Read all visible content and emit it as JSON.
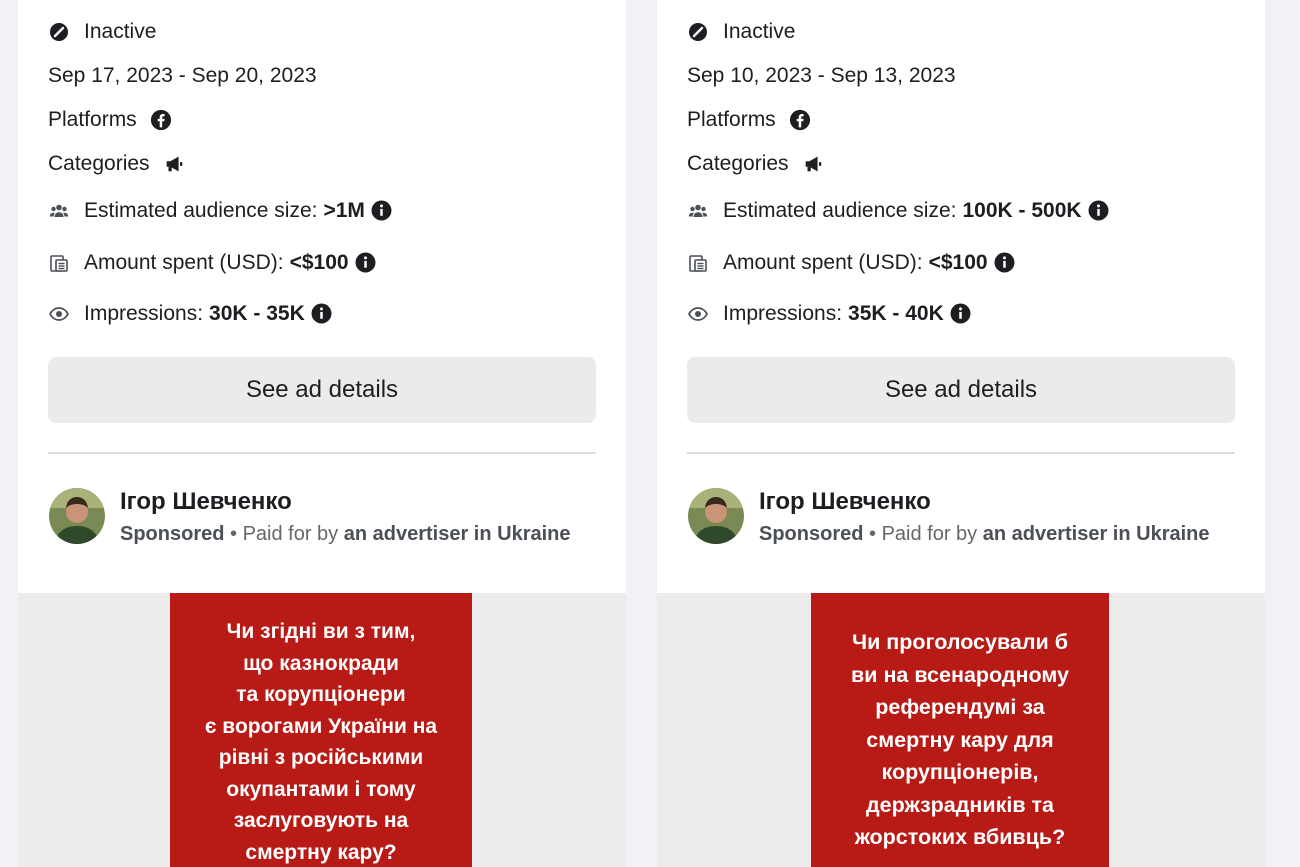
{
  "cards": [
    {
      "status": "Inactive",
      "dates": "Sep 17, 2023 - Sep 20, 2023",
      "platforms_label": "Platforms",
      "categories_label": "Categories",
      "audience_label": "Estimated audience size:",
      "audience_value": ">1M",
      "spent_label": "Amount spent (USD):",
      "spent_value": "<$100",
      "impressions_label": "Impressions:",
      "impressions_value": "30K - 35K",
      "details_button": "See ad details",
      "advertiser_name": "Ігор Шевченко",
      "sponsored": "Sponsored",
      "paid_for_prefix": " • Paid for by ",
      "paid_for_value": "an advertiser in Ukraine",
      "creative_text": "Чи згідні ви з тим,\nщо казнокради\nта корупціонери\nє ворогами України на\nрівні з російськими\nокупантами і тому\nзаслуговують на\nсмертну кару?"
    },
    {
      "status": "Inactive",
      "dates": "Sep 10, 2023 - Sep 13, 2023",
      "platforms_label": "Platforms",
      "categories_label": "Categories",
      "audience_label": "Estimated audience size:",
      "audience_value": "100K - 500K",
      "spent_label": "Amount spent (USD):",
      "spent_value": "<$100",
      "impressions_label": "Impressions:",
      "impressions_value": "35K - 40K",
      "details_button": "See ad details",
      "advertiser_name": "Ігор Шевченко",
      "sponsored": "Sponsored",
      "paid_for_prefix": " • Paid for by ",
      "paid_for_value": "an advertiser in Ukraine",
      "creative_text": "Чи проголосували б\nви на всенародному\nреферендумі за\nсмертну кару для\nкорупціонерів,\nдержзрадників та\nжорстоких вбивць?"
    }
  ],
  "colors": {
    "page_bg": "#f0f2f5",
    "card_bg": "#ffffff",
    "button_bg": "#ebebec",
    "creative_red": "#b81a16",
    "muted_text": "#65676b"
  },
  "icons": {
    "status": "inactive-icon",
    "platform": "facebook-icon",
    "category": "megaphone-icon",
    "audience": "people-icon",
    "spent": "money-icon",
    "impressions": "eye-icon",
    "info": "info-icon"
  }
}
